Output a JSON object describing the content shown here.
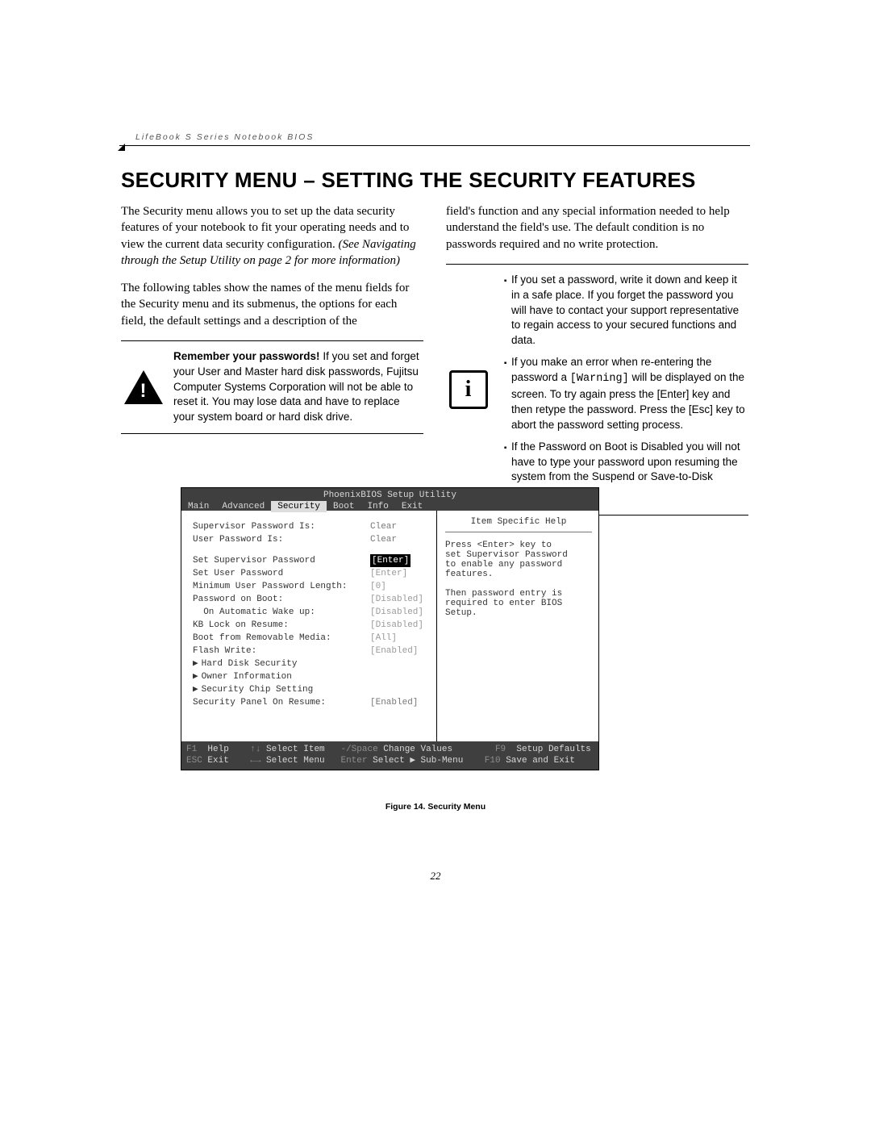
{
  "running_head": "LifeBook S Series Notebook BIOS",
  "title": "SECURITY MENU – SETTING THE SECURITY FEATURES",
  "left_col": {
    "p1a": "The Security menu allows you to set up the data security features of your notebook to fit your operating needs and to view the current data security configuration. ",
    "p1b": "(See Navigating through the Setup Utility on page 2 for more information)",
    "p2": "The following tables show the names of the menu fields for the Security menu and its submenus, the options for each field, the default settings and a description of the",
    "warn_bold": "Remember your passwords!",
    "warn_rest": " If you set and forget your User and Master hard disk passwords, Fujitsu Computer Systems Corporation will not be able to reset it. You may lose data and have to replace your system board or hard disk drive."
  },
  "right_col": {
    "p1": "field's function and any special information needed to help understand the field's use. The default condition is no passwords required and no write protection.",
    "info": {
      "b1": "If you set a password, write it down and keep it in a safe place. If you forget the password you will have to contact your support representative to regain access to your secured functions and data.",
      "b2a": "If you make an error when re-entering the password a ",
      "b2code": "[Warning]",
      "b2b": " will be displayed on the screen. To try again press the [Enter] key and then retype the password. Press the [Esc] key to abort the password setting process.",
      "b3": "If the Password on Boot is Disabled you will not have to type your password upon resuming the system from the Suspend or Save-to-Disk modes."
    }
  },
  "bios": {
    "title": "PhoenixBIOS Setup Utility",
    "tabs": [
      "Main",
      "Advanced",
      "Security",
      "Boot",
      "Info",
      "Exit"
    ],
    "active_tab": "Security",
    "rows": [
      {
        "lbl": "Supervisor Password Is:",
        "val": "Clear",
        "dim": false,
        "hl": false,
        "indent": 0,
        "sub": false
      },
      {
        "lbl": "User Password Is:",
        "val": "Clear",
        "dim": false,
        "hl": false,
        "indent": 0,
        "sub": false
      },
      {
        "spacer": true
      },
      {
        "lbl": "Set Supervisor Password",
        "val": "[Enter]",
        "hl": true,
        "indent": 0,
        "sub": false
      },
      {
        "lbl": "Set User Password",
        "val": "[Enter]",
        "dim": true,
        "indent": 0,
        "sub": false
      },
      {
        "lbl": "Minimum User Password Length:",
        "val": "[0]",
        "dim": true,
        "indent": 0,
        "sub": false
      },
      {
        "lbl": "Password on Boot:",
        "val": "[Disabled]",
        "dim": true,
        "indent": 0,
        "sub": false
      },
      {
        "lbl": "  On Automatic Wake up:",
        "val": "[Disabled]",
        "dim": true,
        "indent": 1,
        "sub": false
      },
      {
        "lbl": "KB Lock on Resume:",
        "val": "[Disabled]",
        "dim": true,
        "indent": 0,
        "sub": false
      },
      {
        "lbl": "Boot from Removable Media:",
        "val": "[All]",
        "dim": true,
        "indent": 0,
        "sub": false
      },
      {
        "lbl": "Flash Write:",
        "val": "[Enabled]",
        "dim": true,
        "indent": 0,
        "sub": false
      },
      {
        "lbl": "Hard Disk Security",
        "val": "",
        "sub": true
      },
      {
        "lbl": "Owner Information",
        "val": "",
        "sub": true
      },
      {
        "lbl": "Security Chip Setting",
        "val": "",
        "sub": true
      },
      {
        "lbl": "Security Panel On Resume:",
        "val": "[Enabled]",
        "dim": false,
        "indent": 0,
        "sub": false
      }
    ],
    "help": {
      "header": "Item Specific Help",
      "l1": "Press <Enter> key to",
      "l2": "set Supervisor Password",
      "l3": "to enable any password",
      "l4": "features.",
      "l5": "",
      "l6": "Then password entry is",
      "l7": "required to enter BIOS",
      "l8": "Setup."
    },
    "footer": {
      "f1_k": "F1",
      "f1_l": "Help",
      "arr1": "↑↓",
      "sel_item": "Select Item",
      "sp": "-/Space",
      "chg": "Change Values",
      "f9_k": "F9",
      "f9_l": "Setup Defaults",
      "esc_k": "ESC",
      "esc_l": "Exit",
      "arr2": "←→",
      "sel_menu": "Select Menu",
      "ent": "Enter",
      "sub": "Select ▶ Sub-Menu",
      "f10_k": "F10",
      "f10_l": "Save and Exit"
    }
  },
  "figure_caption": "Figure 14.   Security Menu",
  "page_number": "22"
}
